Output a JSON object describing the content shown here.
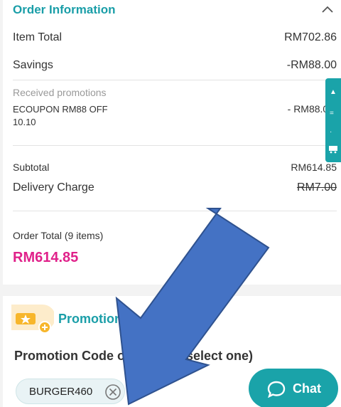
{
  "order_info": {
    "title": "Order Information",
    "item_total_label": "Item Total",
    "item_total_value": "RM702.86",
    "savings_label": "Savings",
    "savings_value": "-RM88.00",
    "received_promotions_label": "Received promotions",
    "promotion_name": "ECOUPON RM88 OFF 10.10",
    "promotion_value": "- RM88.00",
    "subtotal_label": "Subtotal",
    "subtotal_value": "RM614.85",
    "delivery_label": "Delivery Charge",
    "delivery_value": "RM7.00",
    "order_total_label": "Order Total (9 items)",
    "order_total_value": "RM614.85"
  },
  "promotion": {
    "title": "Promotion",
    "code_title": "Promotion Code offers (can select one)",
    "code_value": "BURGER460"
  },
  "chat": {
    "label": "Chat"
  },
  "colors": {
    "accent": "#1a9ea8",
    "total": "#e0218a",
    "arrow": "#4472c4"
  },
  "icons": [
    "chevron-up-icon",
    "ticket-icon",
    "clear-icon",
    "chat-bubble-icon",
    "cart-icon"
  ]
}
